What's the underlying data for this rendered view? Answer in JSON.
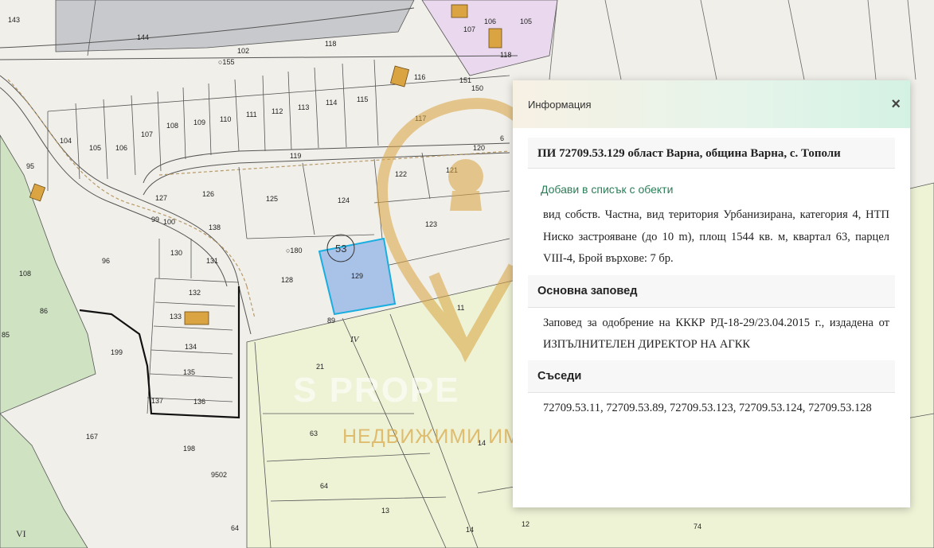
{
  "map": {
    "parcel_labels": [
      "143",
      "144",
      "102",
      "155",
      "118",
      "116",
      "151",
      "150",
      "107",
      "106",
      "105",
      "118",
      "104",
      "105",
      "106",
      "107",
      "108",
      "109",
      "110",
      "111",
      "112",
      "113",
      "114",
      "115",
      "117",
      "120",
      "6",
      "95",
      "119",
      "122",
      "121",
      "127",
      "126",
      "125",
      "124",
      "99",
      "100",
      "138",
      "123",
      "96",
      "130",
      "131",
      "180",
      "53",
      "129",
      "128",
      "108",
      "86",
      "85",
      "132",
      "133",
      "134",
      "135",
      "137",
      "136",
      "199",
      "167",
      "198",
      "89",
      "11",
      "21",
      "63",
      "64",
      "13",
      "14",
      "64",
      "14",
      "74",
      "9502",
      "12"
    ],
    "roman_labels": [
      "IV",
      "VI"
    ],
    "selected_parcel": "129",
    "quarter_circle": "53",
    "colors": {
      "selected_fill": "#a9c2e8",
      "selected_stroke": "#19aee0",
      "green": "#cfe3c3",
      "yellow_green": "#eef3d6",
      "purple": "#ead9ee",
      "building": "#d9a441"
    }
  },
  "watermark": {
    "line1": "S PROPERTIES",
    "line2": "НЕДВИЖИМИ ИМОТИ"
  },
  "popup": {
    "title": "Информация",
    "close_label": "×",
    "parcel_title": "ПИ 72709.53.129 област Варна, община Варна, с. Тополи",
    "add_link": "Добави в списък с обекти",
    "details": "вид собств. Частна, вид територия Урбанизирана, категория 4, НТП Ниско застрояване (до 10 m), площ 1544 кв. м, квартал 63, парцел VIII-4, Брой върхове: 7 бр.",
    "order_heading": "Основна заповед",
    "order_text": "Заповед за одобрение на КККР РД-18-29/23.04.2015 г., издадена от ИЗПЪЛНИТЕЛЕН ДИРЕКТОР НА АГКК",
    "neighbors_heading": "Съседи",
    "neighbors_text": "72709.53.11, 72709.53.89, 72709.53.123, 72709.53.124, 72709.53.128"
  }
}
